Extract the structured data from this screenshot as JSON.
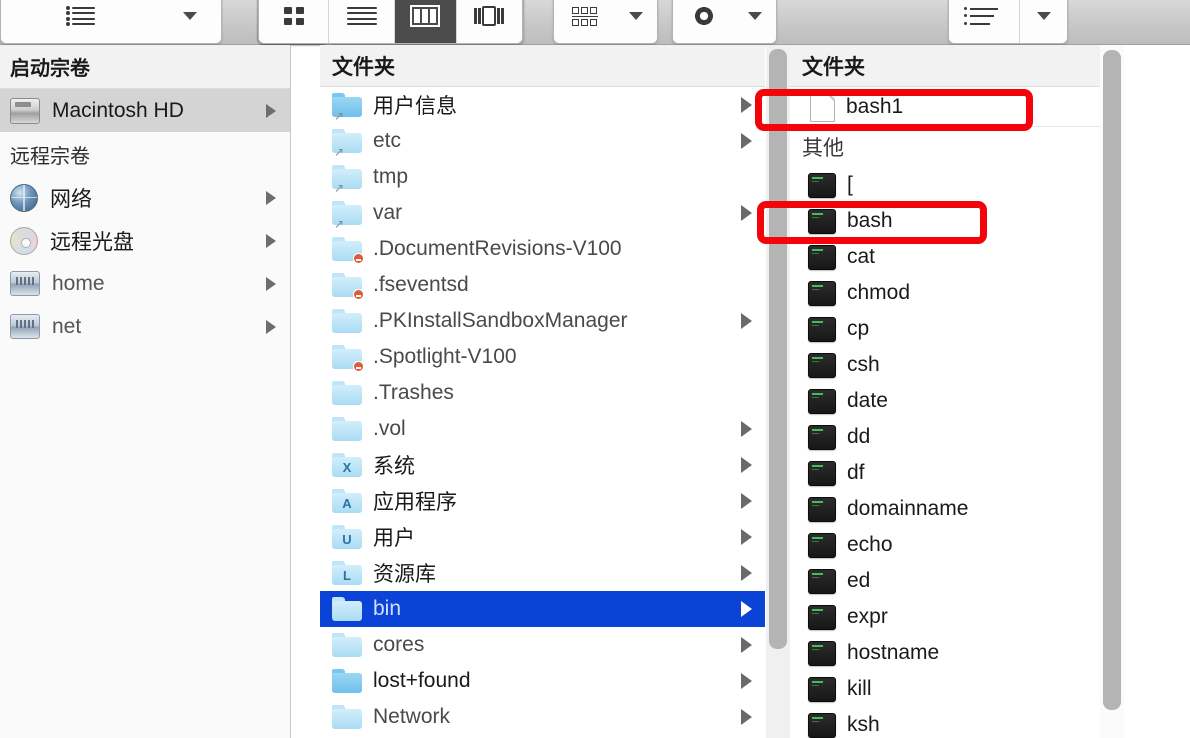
{
  "toolbar": {
    "groups": [
      {
        "name": "view-options",
        "buttons": [
          {
            "icon": "list-lines-icon",
            "label": ""
          },
          {
            "icon": "chevron-down-icon",
            "label": ""
          }
        ]
      },
      {
        "name": "view-mode",
        "buttons": [
          {
            "icon": "icon-view-icon",
            "label": "",
            "selected": false
          },
          {
            "icon": "list-view-icon",
            "label": "",
            "selected": false
          },
          {
            "icon": "column-view-icon",
            "label": "",
            "selected": true
          },
          {
            "icon": "coverflow-view-icon",
            "label": "",
            "selected": false
          }
        ]
      },
      {
        "name": "arrange",
        "buttons": [
          {
            "icon": "arrange-grid-icon",
            "label": ""
          },
          {
            "icon": "chevron-down-icon",
            "label": ""
          }
        ]
      },
      {
        "name": "action",
        "buttons": [
          {
            "icon": "gear-icon",
            "label": ""
          },
          {
            "icon": "chevron-down-icon",
            "label": ""
          }
        ]
      },
      {
        "name": "sort",
        "buttons": [
          {
            "icon": "sort-list-icon",
            "label": ""
          },
          {
            "icon": "chevron-down-icon",
            "label": ""
          }
        ]
      }
    ]
  },
  "sidebar": {
    "section_startup": "启动宗卷",
    "section_remote": "远程宗卷",
    "startup_items": [
      {
        "label": "Macintosh HD",
        "icon": "hard-drive-icon",
        "selected": true,
        "disclosure": true,
        "dim": false
      }
    ],
    "remote_items": [
      {
        "label": "网络",
        "icon": "globe-icon",
        "selected": false,
        "disclosure": true,
        "dim": false
      },
      {
        "label": "远程光盘",
        "icon": "disc-icon",
        "selected": false,
        "disclosure": true,
        "dim": false
      },
      {
        "label": "home",
        "icon": "server-icon",
        "selected": false,
        "disclosure": true,
        "dim": true
      },
      {
        "label": "net",
        "icon": "server-icon",
        "selected": false,
        "disclosure": true,
        "dim": true
      }
    ]
  },
  "column_middle": {
    "header": "文件夹",
    "rows": [
      {
        "label": "用户信息",
        "icon": "folder",
        "style": "solid",
        "badge": "alias",
        "disclosure": true,
        "dim": false,
        "selected": false
      },
      {
        "label": "etc",
        "icon": "folder",
        "style": "pale",
        "badge": "alias",
        "disclosure": true,
        "dim": true,
        "selected": false
      },
      {
        "label": "tmp",
        "icon": "folder",
        "style": "pale",
        "badge": "alias",
        "disclosure": false,
        "dim": true,
        "selected": false
      },
      {
        "label": "var",
        "icon": "folder",
        "style": "pale",
        "badge": "alias",
        "disclosure": true,
        "dim": true,
        "selected": false
      },
      {
        "label": ".DocumentRevisions-V100",
        "icon": "folder",
        "style": "pale",
        "badge": "deny",
        "disclosure": false,
        "dim": true,
        "selected": false
      },
      {
        "label": ".fseventsd",
        "icon": "folder",
        "style": "pale",
        "badge": "deny",
        "disclosure": false,
        "dim": true,
        "selected": false
      },
      {
        "label": ".PKInstallSandboxManager",
        "icon": "folder",
        "style": "pale",
        "badge": "none",
        "disclosure": true,
        "dim": true,
        "selected": false
      },
      {
        "label": ".Spotlight-V100",
        "icon": "folder",
        "style": "pale",
        "badge": "deny",
        "disclosure": false,
        "dim": true,
        "selected": false
      },
      {
        "label": ".Trashes",
        "icon": "folder",
        "style": "pale",
        "badge": "none",
        "disclosure": false,
        "dim": true,
        "selected": false
      },
      {
        "label": ".vol",
        "icon": "folder",
        "style": "pale",
        "badge": "none",
        "disclosure": true,
        "dim": true,
        "selected": false
      },
      {
        "label": "系统",
        "icon": "folder-system",
        "style": "pale",
        "badge": "none",
        "glyph": "X",
        "disclosure": true,
        "dim": false,
        "selected": false
      },
      {
        "label": "应用程序",
        "icon": "folder-applications",
        "style": "pale",
        "badge": "none",
        "glyph": "A",
        "disclosure": true,
        "dim": false,
        "selected": false
      },
      {
        "label": "用户",
        "icon": "folder-users",
        "style": "pale",
        "badge": "none",
        "glyph": "U",
        "disclosure": true,
        "dim": false,
        "selected": false
      },
      {
        "label": "资源库",
        "icon": "folder-library",
        "style": "pale",
        "badge": "none",
        "glyph": "L",
        "disclosure": true,
        "dim": false,
        "selected": false
      },
      {
        "label": "bin",
        "icon": "folder",
        "style": "pale",
        "badge": "none",
        "disclosure": true,
        "dim": false,
        "selected": true
      },
      {
        "label": "cores",
        "icon": "folder",
        "style": "pale",
        "badge": "none",
        "disclosure": true,
        "dim": true,
        "selected": false
      },
      {
        "label": "lost+found",
        "icon": "folder",
        "style": "solid",
        "badge": "none",
        "disclosure": true,
        "dim": false,
        "selected": false
      },
      {
        "label": "Network",
        "icon": "folder",
        "style": "pale",
        "badge": "none",
        "disclosure": true,
        "dim": true,
        "selected": false
      }
    ]
  },
  "column_right": {
    "header": "文件夹",
    "group_other": "其他",
    "folder_rows": [
      {
        "label": "bash1",
        "icon": "document",
        "dim": false
      }
    ],
    "other_rows": [
      {
        "label": "[",
        "icon": "executable"
      },
      {
        "label": "bash",
        "icon": "executable"
      },
      {
        "label": "cat",
        "icon": "executable"
      },
      {
        "label": "chmod",
        "icon": "executable"
      },
      {
        "label": "cp",
        "icon": "executable"
      },
      {
        "label": "csh",
        "icon": "executable"
      },
      {
        "label": "date",
        "icon": "executable"
      },
      {
        "label": "dd",
        "icon": "executable"
      },
      {
        "label": "df",
        "icon": "executable"
      },
      {
        "label": "domainname",
        "icon": "executable"
      },
      {
        "label": "echo",
        "icon": "executable"
      },
      {
        "label": "ed",
        "icon": "executable"
      },
      {
        "label": "expr",
        "icon": "executable"
      },
      {
        "label": "hostname",
        "icon": "executable"
      },
      {
        "label": "kill",
        "icon": "executable"
      },
      {
        "label": "ksh",
        "icon": "executable"
      }
    ]
  },
  "annotations": [
    {
      "name": "highlight-bash1",
      "target": "bash1",
      "color": "#f4040a"
    },
    {
      "name": "highlight-bash",
      "target": "bash",
      "color": "#f4040a"
    }
  ],
  "colors": {
    "selection_blue": "#0b43d6",
    "annotation_red": "#f4040a",
    "sidebar_selection": "#d4d4d4"
  }
}
